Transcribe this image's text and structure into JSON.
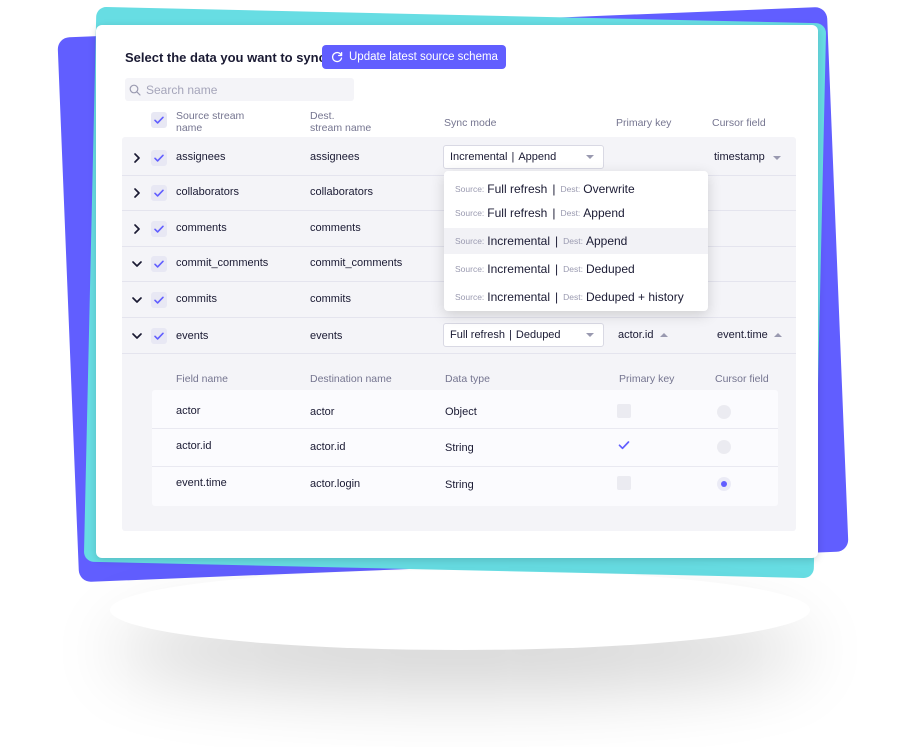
{
  "header": {
    "title": "Select the data you want to sync",
    "update_button": "Update latest source schema",
    "search_placeholder": "Search name"
  },
  "columns": {
    "source_line1": "Source stream",
    "source_line2": "name",
    "dest_line1": "Dest.",
    "dest_line2": "stream name",
    "sync_mode": "Sync mode",
    "primary_key": "Primary key",
    "cursor_field": "Cursor field"
  },
  "streams": [
    {
      "source": "assignees",
      "dest": "assignees",
      "expanded": false
    },
    {
      "source": "collaborators",
      "dest": "collaborators",
      "expanded": false
    },
    {
      "source": "comments",
      "dest": "comments",
      "expanded": false
    },
    {
      "source": "commit_comments",
      "dest": "commit_comments",
      "expanded": true
    },
    {
      "source": "commits",
      "dest": "commits",
      "expanded": true
    },
    {
      "source": "events",
      "dest": "events",
      "expanded": true
    }
  ],
  "assignees_sync": {
    "left": "Incremental",
    "right": "Append",
    "cursor": "timestamp"
  },
  "events_sync": {
    "left": "Full refresh",
    "right": "Deduped",
    "primary_key": "actor.id",
    "cursor": "event.time"
  },
  "dropdown": {
    "source_label": "Source:",
    "dest_label": "Dest:",
    "options": [
      {
        "source": "Full refresh",
        "dest": "Overwrite"
      },
      {
        "source": "Full refresh",
        "dest": "Append"
      },
      {
        "source": "Incremental",
        "dest": "Append"
      },
      {
        "source": "Incremental",
        "dest": "Deduped"
      },
      {
        "source": "Incremental",
        "dest": "Deduped + history"
      }
    ],
    "highlighted_index": 2
  },
  "fields": {
    "headers": {
      "field_name": "Field name",
      "destination_name": "Destination name",
      "data_type": "Data type",
      "primary_key": "Primary key",
      "cursor_field": "Cursor field"
    },
    "rows": [
      {
        "name": "actor",
        "dest": "actor",
        "type": "Object",
        "primary_key": false,
        "cursor": false
      },
      {
        "name": "actor.id",
        "dest": "actor.id",
        "type": "String",
        "primary_key": true,
        "cursor": false
      },
      {
        "name": "event.time",
        "dest": "actor.login",
        "type": "String",
        "primary_key": false,
        "cursor": true
      }
    ]
  },
  "colors": {
    "accent": "#615eff",
    "teal": "#67dde3"
  },
  "icons": [
    "refresh-icon",
    "search-icon",
    "check-icon",
    "chevron-right-icon",
    "chevron-down-icon"
  ]
}
